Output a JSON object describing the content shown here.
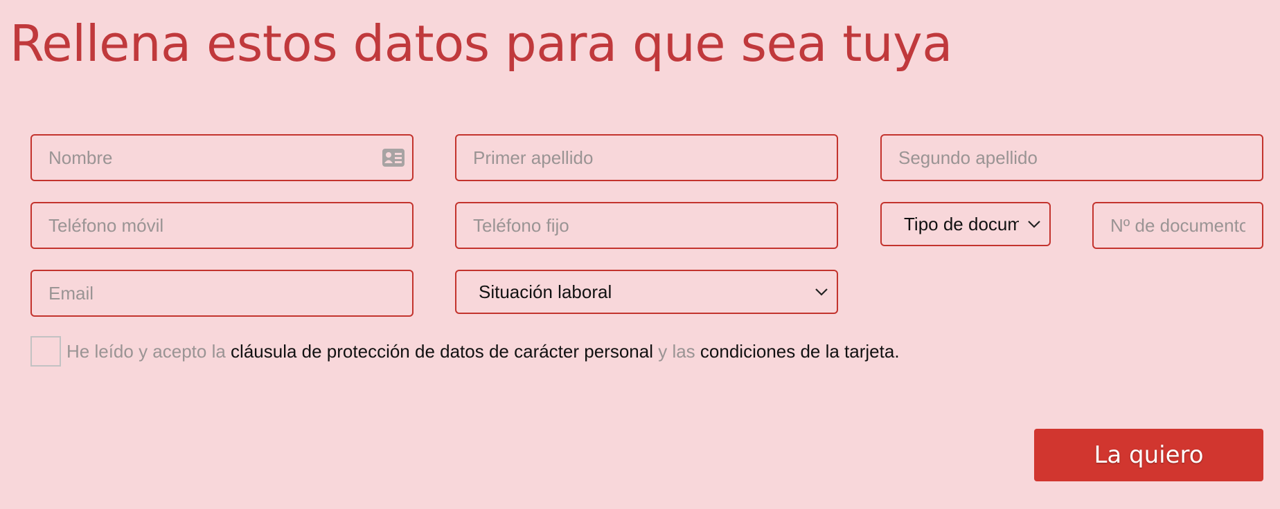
{
  "page": {
    "title": "Rellena estos datos para que sea tuya"
  },
  "form": {
    "nombre": {
      "placeholder": "Nombre",
      "icon": "id-card-icon"
    },
    "primer_apellido": {
      "placeholder": "Primer apellido"
    },
    "segundo_apellido": {
      "placeholder": "Segundo apellido"
    },
    "telefono_movil": {
      "placeholder": "Teléfono móvil"
    },
    "telefono_fijo": {
      "placeholder": "Teléfono fijo"
    },
    "tipo_documento": {
      "selected": "Tipo de documento",
      "icon": "chevron-down-icon"
    },
    "numero_documento": {
      "placeholder": "Nº de documento"
    },
    "email": {
      "placeholder": "Email"
    },
    "situacion_laboral": {
      "selected": "Situación laboral",
      "icon": "chevron-down-icon"
    }
  },
  "consent": {
    "text_1": "He leído y acepto la",
    "link_1": "cláusula de protección de datos de carácter personal",
    "text_2": "y las",
    "link_2": "condiciones de la tarjeta."
  },
  "submit": {
    "label": "La quiero"
  },
  "colors": {
    "background": "#f8d7da",
    "accent": "#c3332d",
    "button": "#d1362f",
    "title": "#c0393c",
    "placeholder": "#9a9494"
  }
}
